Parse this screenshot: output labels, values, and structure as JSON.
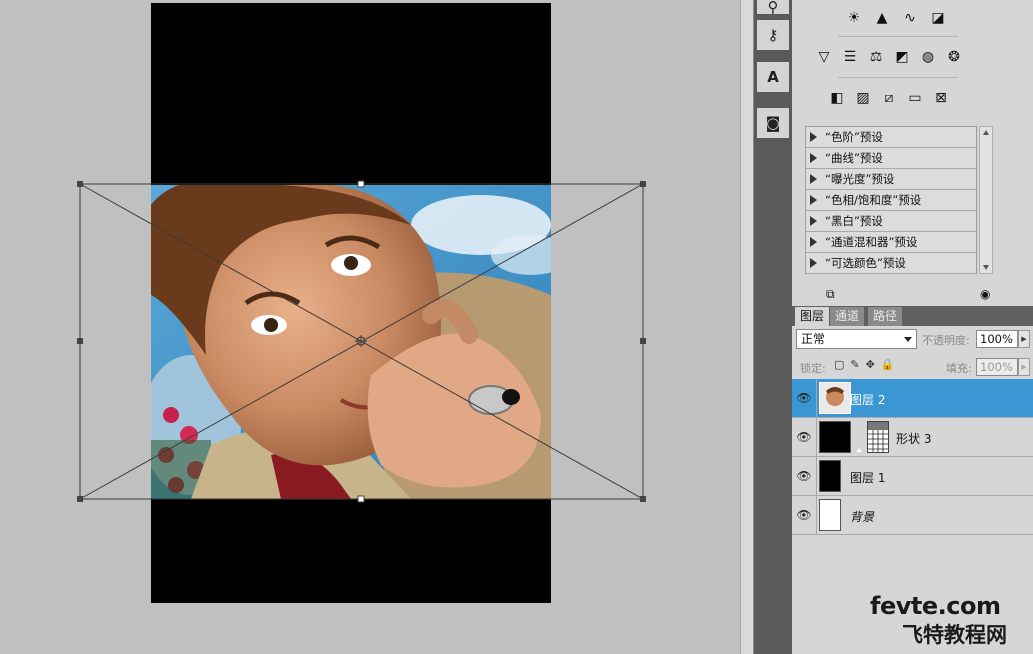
{
  "adjustments": {
    "row1_icons": [
      "brightness-icon",
      "levels-icon",
      "curves-icon",
      "exposure-icon"
    ],
    "row2_icons": [
      "vibrance-icon",
      "hue-saturation-icon",
      "color-balance-icon",
      "black-white-icon",
      "photo-filter-icon",
      "channel-mixer-icon"
    ],
    "row3_icons": [
      "invert-icon",
      "posterize-icon",
      "threshold-icon",
      "gradient-map-icon",
      "selective-color-icon"
    ],
    "presets": [
      "“色阶”预设",
      "“曲线”预设",
      "“曝光度”预设",
      "“色相/饱和度”预设",
      "“黑白”预设",
      "“通道混和器”预设",
      "“可选颜色”预设"
    ]
  },
  "layers_panel": {
    "tabs": [
      "图层",
      "通道",
      "路径"
    ],
    "blend_mode": "正常",
    "opacity_label": "不透明度:",
    "opacity_value": "100%",
    "lock_label": "锁定:",
    "fill_label": "填充:",
    "fill_value": "100%",
    "layers": [
      {
        "name": "图层 2",
        "selected": true
      },
      {
        "name": "形状 3",
        "selected": false
      },
      {
        "name": "图层 1",
        "selected": false
      },
      {
        "name": "背景",
        "selected": false
      }
    ]
  },
  "watermark": {
    "line1": "fevte.com",
    "line2": "飞特教程网"
  },
  "colors": {
    "selection": "#3a97d4",
    "panel_bg": "#d6d6d6",
    "canvas_bg": "#c0c0c0"
  }
}
